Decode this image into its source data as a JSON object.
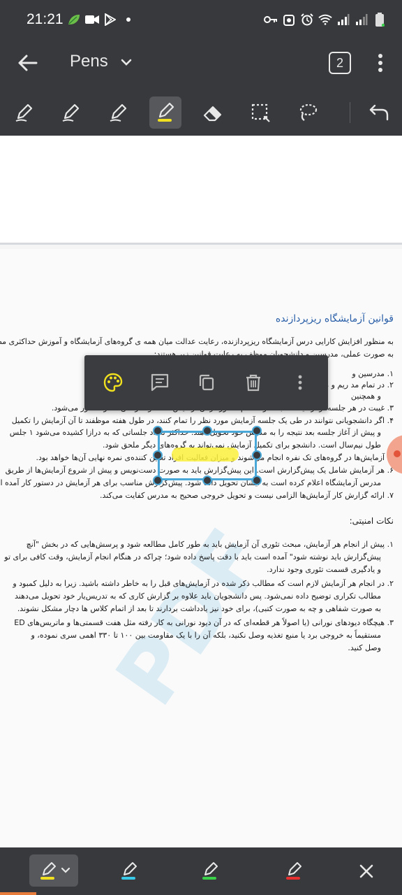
{
  "status_bar": {
    "time": "21:21",
    "left_icons": [
      "leaf-icon",
      "video-camera-icon",
      "play-store-icon",
      "dot-icon"
    ],
    "right_icons": [
      "vpn-key-icon",
      "security-icon",
      "alarm-icon",
      "wifi-icon",
      "signal-icon",
      "signal-icon",
      "battery-icon"
    ]
  },
  "app_bar": {
    "title": "Pens",
    "page_count": "2"
  },
  "toolbar": {
    "tools": [
      "pen-1",
      "pen-2",
      "pen-3",
      "highlighter",
      "eraser",
      "select-rect",
      "lasso"
    ],
    "active_tool": "highlighter",
    "accent_color": "#f0e020"
  },
  "document": {
    "title": "قوانین آزمایشگاه ریزپردازنده",
    "intro": [
      "به منظور افزایش کارایی درس آزمایشگاه ریزپردازنده، رعایت عدالت میان همه ی گروه‌های آزمایشگاه و آموزش حداکثری مطالب",
      "به صورت عملی، مدرسین و دانشجویان موظف به رعایت قوانین زیر هستند:"
    ],
    "rules": [
      {
        "n": "۱.",
        "lines": [
          "مدرسین و"
        ]
      },
      {
        "n": "۲.",
        "lines": [
          "در تمام مد                                                                                 ریم و میکروفون خود را فعال",
          "و همچنین"
        ]
      },
      {
        "n": "۳.",
        "lines": [
          "غیبت در هر جلسه از آزمایشگاه به منزله عدم حضور در آن آزمایش است و نمره آن صفر منظور می‌شود."
        ]
      },
      {
        "n": "۴.",
        "lines": [
          "اگر دانشجویانی نتوانند در طی یک جلسه آزمایش مورد نظر را تمام کنند، در طول هفته موظفند تا آن آزمایش را تکمیل",
          "و پیش از آغاز جلسه بعد نتیجه را به مدرس خود تحویل دهند. حداکثر تعداد جلساتی که به درازا کشیده می‌شود ۱ جلس",
          "طول نیم‌سال است. دانشجو برای تکمیل آزمایش نمی‌تواند به گروه‌های دیگر ملحق شود."
        ]
      },
      {
        "n": "۵.",
        "lines": [
          "آزمایش‌ها در گروه‌های تک نفره انجام می‌شوند و میزان فعالیت افراد تعیین کننده‌ی نمره نهایی آن‌ها خواهد بود."
        ]
      },
      {
        "n": "۶.",
        "lines": [
          "هر آزمایش شامل یک پیش‌گزارش است. این پیش‌گزارش باید به صورت دست‌نویس و پیش از شروع آزمایش‌ها از طریق",
          "مدرس آزمایشگاه اعلام کرده است به ایشان تحویل داده شود. پیش‌گزارش مناسب برای هر آزمایش در دستور کار آمده ا"
        ]
      },
      {
        "n": "۷.",
        "lines": [
          "ارائه گزارش کار آزمایش‌ها الزامی نیست و تحویل خروجی صحیح به مدرس کفایت می‌کند."
        ]
      }
    ],
    "safety_title": "نکات امنیتی:",
    "safety": [
      {
        "n": "۱.",
        "lines": [
          "پیش از انجام هر آزمایش، مبحث تئوری آن آزمایش باید به طور کامل مطالعه شود و پرسش‌هایی که در بخش \"آنچ",
          "پیش‌گزارش باید نوشته شود\" آمده است باید با دقت پاسخ داده شود؛ چراکه در هنگام انجام آزمایش، وقت کافی برای تو",
          "و یادگیری قسمت تئوری وجود ندارد."
        ]
      },
      {
        "n": "۲.",
        "lines": [
          "در انجام هر آزمایش لازم است که مطالب ذکر شده در آزمایش‌های قبل را به خاطر داشته باشید. زیرا به دلیل کمبود و",
          "مطالب تکراری توضیح داده نمی‌شود. پس دانشجویان باید علاوه بر گزارش کاری که به تدریس‌یار خود تحویل می‌دهند",
          "به صورت شفاهی و چه به صورت کتبی)، برای خود نیز یادداشت بردارند تا بعد از اتمام کلاس ها دچار مشکل نشوند."
        ]
      },
      {
        "n": "۳.",
        "lines": [
          "هیچگاه دیودهای نورانی (یا اصولاً هر قطعه‌ای که در آن دیود نورانی به کار رفته مثل هفت قسمتی‌ها و ماتریس‌های ED",
          "مستقیماً به خروجی برد یا منبع تغذیه وصل نکنید، بلکه آن را با یک مقاومت بین ۱۰۰ تا ۳۳۰ اهمی سری نموده، و",
          "وصل کنید."
        ]
      }
    ],
    "watermark": "PDF"
  },
  "context_menu": {
    "items": [
      "palette-icon",
      "comment-icon",
      "copy-icon",
      "delete-icon",
      "more-vert-icon"
    ]
  },
  "pen_tray": {
    "pens": [
      {
        "icon": "pen-icon",
        "color": "#f0e020"
      },
      {
        "icon": "pen-icon",
        "color": "#38c8e8"
      },
      {
        "icon": "pen-icon",
        "color": "#3ad04a"
      },
      {
        "icon": "pen-icon",
        "color": "#e83030"
      }
    ]
  }
}
